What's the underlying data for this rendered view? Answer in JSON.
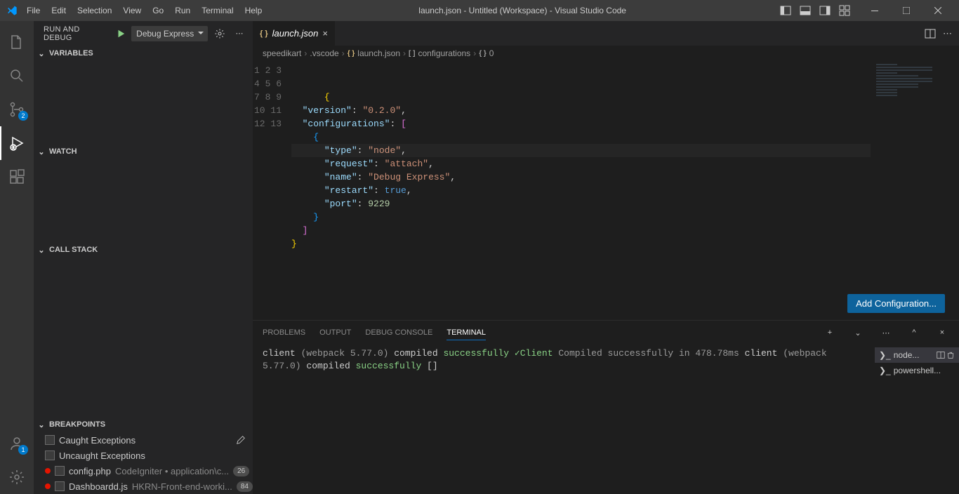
{
  "title": "launch.json - Untitled (Workspace) - Visual Studio Code",
  "menus": [
    "File",
    "Edit",
    "Selection",
    "View",
    "Go",
    "Run",
    "Terminal",
    "Help"
  ],
  "activity": {
    "scm_badge": "2",
    "accounts_badge": "1"
  },
  "sidebar": {
    "title": "RUN AND DEBUG",
    "config_selected": "Debug Express",
    "sections": {
      "variables": "VARIABLES",
      "watch": "WATCH",
      "callstack": "CALL STACK",
      "breakpoints": "BREAKPOINTS"
    },
    "breakpoints": {
      "caught": "Caught Exceptions",
      "uncaught": "Uncaught Exceptions",
      "items": [
        {
          "file": "config.php",
          "path": "CodeIgniter • application\\c...",
          "count": "26"
        },
        {
          "file": "Dashboardd.js",
          "path": "HKRN-Front-end-worki...",
          "count": "84"
        }
      ]
    }
  },
  "tab": {
    "label": "launch.json"
  },
  "breadcrumb": [
    "speedikart",
    ".vscode",
    "launch.json",
    "configurations",
    "0"
  ],
  "add_config_btn": "Add Configuration...",
  "code": {
    "version": "0.2.0",
    "type": "node",
    "request": "attach",
    "name": "Debug Express",
    "restart": "true",
    "port": "9229"
  },
  "panel": {
    "tabs": [
      "PROBLEMS",
      "OUTPUT",
      "DEBUG CONSOLE",
      "TERMINAL"
    ],
    "active": "TERMINAL",
    "terminal_lines": [
      {
        "type": "compiled",
        "pre": "client ",
        "mid": "(webpack 5.77.0)",
        "post": " compiled ",
        "ok": "successfully"
      },
      {
        "type": "blank"
      },
      {
        "type": "check",
        "label": "Client"
      },
      {
        "type": "dim",
        "text": "  Compiled successfully in 478.78ms"
      },
      {
        "type": "blank"
      },
      {
        "type": "compiled",
        "pre": "client ",
        "mid": "(webpack 5.77.0)",
        "post": " compiled ",
        "ok": "successfully"
      },
      {
        "type": "cursor",
        "text": "[]"
      }
    ],
    "terminals": [
      {
        "label": "node...",
        "active": true
      },
      {
        "label": "powershell...",
        "active": false
      }
    ]
  }
}
